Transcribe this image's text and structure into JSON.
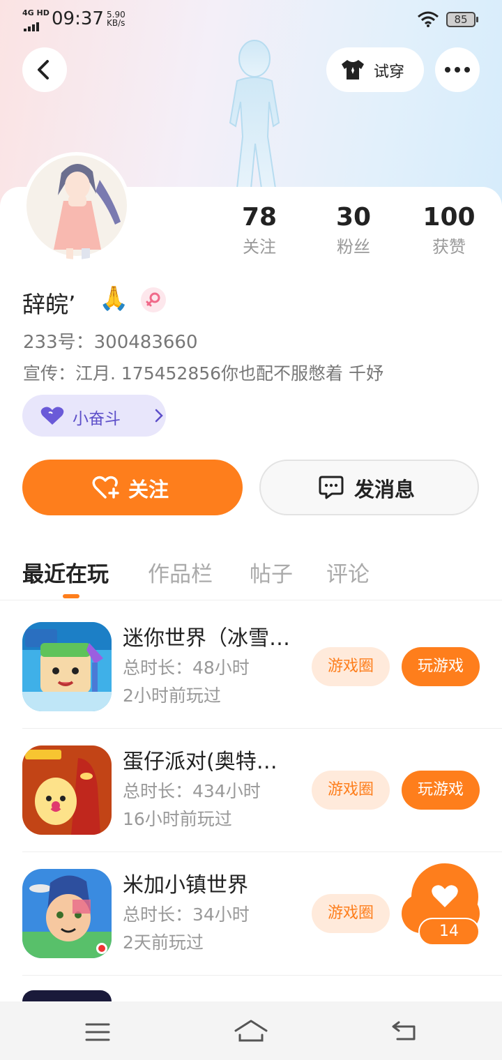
{
  "status": {
    "network": "4G HD",
    "time": "09:37",
    "speed": "5.90 KB/s",
    "battery": "85"
  },
  "header": {
    "tryon_label": "试穿"
  },
  "profile": {
    "stats": [
      {
        "num": "78",
        "label": "关注"
      },
      {
        "num": "30",
        "label": "粉丝"
      },
      {
        "num": "100",
        "label": "获赞"
      }
    ],
    "name": "辞皖’",
    "emoji": "🙏",
    "id_line": "233号：300483660",
    "bio": "宣传：江月. 175452856你也配不服憋着 千妤",
    "tag": "小奋斗"
  },
  "actions": {
    "follow": "关注",
    "message": "发消息"
  },
  "tabs": [
    "最近在玩",
    "作品栏",
    "帖子",
    "评论"
  ],
  "games": [
    {
      "title": "迷你世界（冰雪…",
      "duration": "总时长：48小时",
      "last": "2小时前玩过",
      "circle": "游戏圈",
      "play": "玩游戏"
    },
    {
      "title": "蛋仔派对(奥特…",
      "duration": "总时长：434小时",
      "last": "16小时前玩过",
      "circle": "游戏圈",
      "play": "玩游戏"
    },
    {
      "title": "米加小镇世界",
      "duration": "总时长：34小时",
      "last": "2天前玩过",
      "circle": "游戏圈",
      "play": "玩游戏"
    }
  ],
  "like_count": "14",
  "colors": {
    "accent": "#fe7e1c",
    "tag_bg": "#e8e6fb",
    "tag_text": "#5d4fc9"
  }
}
